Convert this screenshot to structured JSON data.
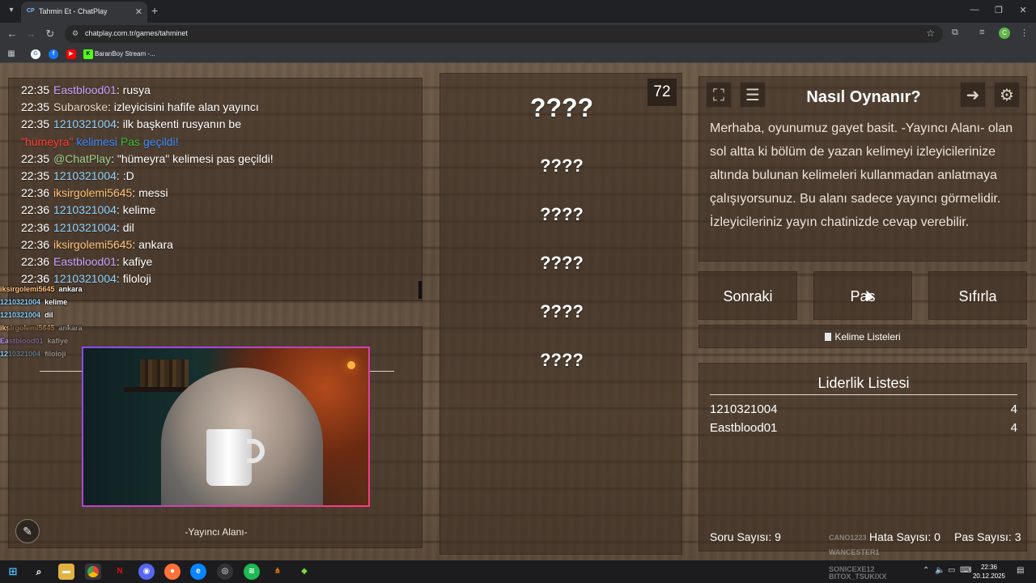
{
  "browser": {
    "tab_favicon": "CP",
    "tab_title": "Tahmin Et - ChatPlay",
    "url": "chatplay.com.tr/games/tahminet",
    "bookmark_label": "BaranBoy Stream -...",
    "profile_initial": "C"
  },
  "chat": {
    "lines": [
      {
        "time": "22:35",
        "user": "Eastblood01",
        "color": "#c9a0ff",
        "message": "rusya"
      },
      {
        "time": "22:35",
        "user": "Subaroske",
        "color": "#e6d3c2",
        "message": "izleyicisini hafife alan yayıncı"
      },
      {
        "time": "22:35",
        "user": "1210321004",
        "color": "#8fd3ff",
        "message": "ilk başkenti rusyanın be"
      },
      {
        "time": "",
        "user": "\"hümeyra\"",
        "color": "#ff3b3b",
        "message": "kelimesi",
        "message_color": "#3b8bff",
        "extra": "Pas",
        "extra_color": "#3bbf3b",
        "extra2": "geçildi!",
        "extra2_color": "#3b8bff"
      },
      {
        "time": "22:35",
        "user": "@ChatPlay",
        "color": "#9fd18b",
        "message": "\"hümeyra\" kelimesi pas geçildi!"
      },
      {
        "time": "22:35",
        "user": "1210321004",
        "color": "#8fd3ff",
        "message": ":D"
      },
      {
        "time": "22:36",
        "user": "iksirgolemi5645",
        "color": "#ffc27a",
        "message": "messi"
      },
      {
        "time": "22:36",
        "user": "1210321004",
        "color": "#8fd3ff",
        "message": "kelime"
      },
      {
        "time": "22:36",
        "user": "1210321004",
        "color": "#8fd3ff",
        "message": "dil"
      },
      {
        "time": "22:36",
        "user": "iksirgolemi5645",
        "color": "#ffc27a",
        "message": "ankara"
      },
      {
        "time": "22:36",
        "user": "Eastblood01",
        "color": "#c9a0ff",
        "message": "kafiye"
      },
      {
        "time": "22:36",
        "user": "1210321004",
        "color": "#8fd3ff",
        "message": "filoloji"
      }
    ],
    "overlay": [
      {
        "user": "iksirgolemi5645",
        "color": "#ffc27a",
        "message": "ankara"
      },
      {
        "user": "1210321004",
        "color": "#8fd3ff",
        "message": "kelime"
      },
      {
        "user": "1210321004",
        "color": "#8fd3ff",
        "message": "dil"
      },
      {
        "user": "iksirgolemi5645",
        "color": "#ffc27a",
        "message": "ankara"
      },
      {
        "user": "Eastblood01",
        "color": "#c9a0ff",
        "message": "kafiye"
      },
      {
        "user": "1210321004",
        "color": "#8fd3ff",
        "message": "filoloji"
      }
    ]
  },
  "streamer": {
    "label": "-Yayıncı Alanı-"
  },
  "game": {
    "timer": "72",
    "main_word": "????",
    "words": [
      "????",
      "????",
      "????",
      "????",
      "????"
    ]
  },
  "howto": {
    "title": "Nasıl Oynanır?",
    "text": "Merhaba, oyunumuz gayet basit. -Yayıncı Alanı- olan sol altta ki bölüm de yazan kelimeyi izleyicilerinize altında bulunan kelimeleri kullanmadan anlatmaya çalışıyorsunuz. Bu alanı sadece yayıncı görmelidir. İzleyicileriniz yayın chatinizde cevap verebilir."
  },
  "buttons": {
    "next": "Sonraki",
    "pass": "Pas",
    "reset": "Sıfırla",
    "word_lists": "Kelime Listeleri"
  },
  "leaderboard": {
    "title": "Liderlik Listesi",
    "rows": [
      {
        "name": "1210321004",
        "score": "4"
      },
      {
        "name": "Eastblood01",
        "score": "4"
      }
    ]
  },
  "stats": {
    "questions": "Soru Sayısı: 9",
    "errors": "Hata Sayısı: 0",
    "passes": "Pas Sayısı: 3"
  },
  "ghost_names": [
    "CANO1223",
    "WANCESTER1",
    "SONICEXE12",
    "BITOX_TSUKIXX"
  ],
  "taskbar": {
    "time": "22:36",
    "date": "20.12.2025"
  }
}
